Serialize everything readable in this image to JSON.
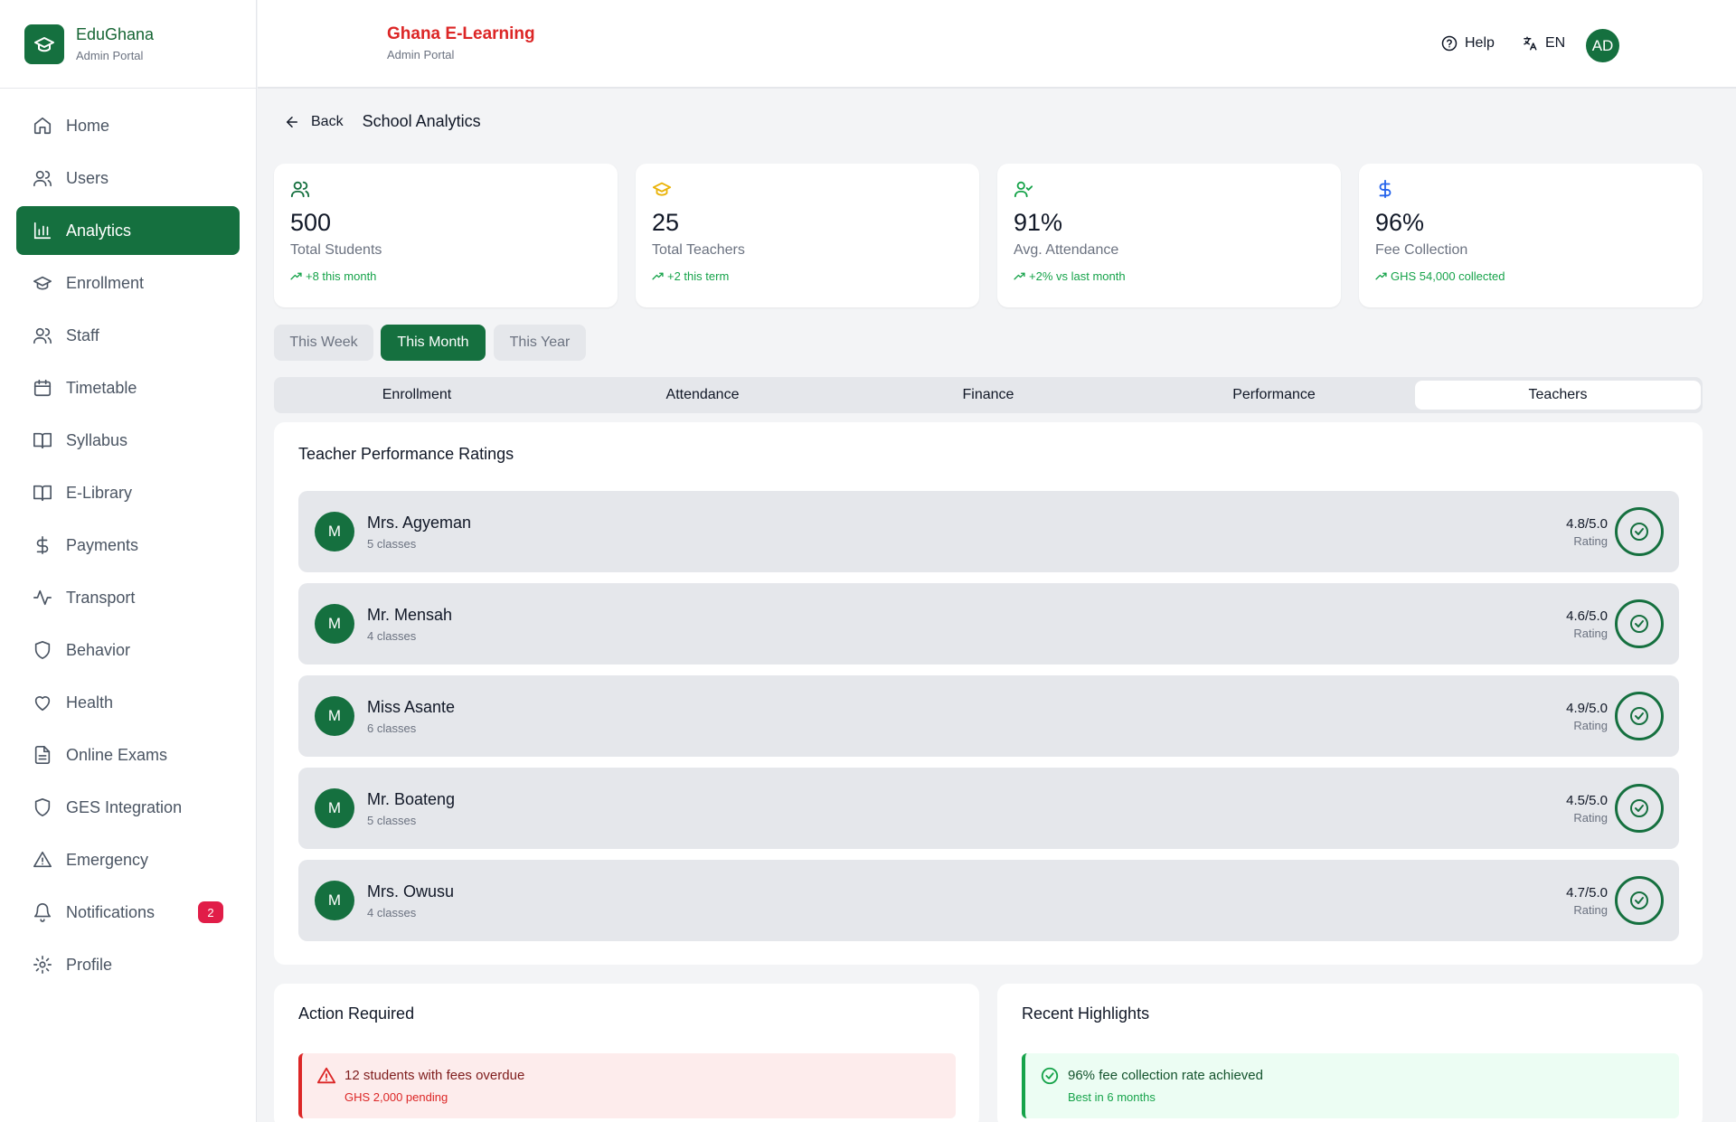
{
  "brand": {
    "name": "EduGhana",
    "subtitle": "Admin Portal"
  },
  "sidebar": {
    "items": [
      {
        "label": "Home",
        "icon": "home-icon"
      },
      {
        "label": "Users",
        "icon": "users-icon"
      },
      {
        "label": "Analytics",
        "icon": "bar-chart-icon",
        "active": true
      },
      {
        "label": "Enrollment",
        "icon": "graduation-cap-icon"
      },
      {
        "label": "Staff",
        "icon": "users-icon"
      },
      {
        "label": "Timetable",
        "icon": "calendar-icon"
      },
      {
        "label": "Syllabus",
        "icon": "book-open-icon"
      },
      {
        "label": "E-Library",
        "icon": "book-open-icon"
      },
      {
        "label": "Payments",
        "icon": "dollar-icon"
      },
      {
        "label": "Transport",
        "icon": "activity-icon"
      },
      {
        "label": "Behavior",
        "icon": "shield-icon"
      },
      {
        "label": "Health",
        "icon": "heart-icon"
      },
      {
        "label": "Online Exams",
        "icon": "file-text-icon"
      },
      {
        "label": "GES Integration",
        "icon": "shield-icon"
      },
      {
        "label": "Emergency",
        "icon": "alert-triangle-icon"
      },
      {
        "label": "Notifications",
        "icon": "bell-icon",
        "badge": "2"
      },
      {
        "label": "Profile",
        "icon": "gear-icon"
      }
    ]
  },
  "header": {
    "title": "Ghana E-Learning",
    "subtitle": "Admin Portal",
    "help": "Help",
    "lang": "EN",
    "avatar": "AD"
  },
  "breadcrumb": {
    "back": "Back",
    "title": "School Analytics"
  },
  "stats": [
    {
      "value": "500",
      "label": "Total Students",
      "trend": "+8 this month",
      "icon": "users-icon",
      "color": "#15703f"
    },
    {
      "value": "25",
      "label": "Total Teachers",
      "trend": "+2 this term",
      "icon": "graduation-cap-icon",
      "color": "#eab308"
    },
    {
      "value": "91%",
      "label": "Avg. Attendance",
      "trend": "+2% vs last month",
      "icon": "user-check-icon",
      "color": "#16a34a"
    },
    {
      "value": "96%",
      "label": "Fee Collection",
      "trend": "GHS 54,000 collected",
      "icon": "dollar-icon",
      "color": "#2563eb"
    }
  ],
  "periods": [
    {
      "label": "This Week"
    },
    {
      "label": "This Month",
      "active": true
    },
    {
      "label": "This Year"
    }
  ],
  "tabs": [
    {
      "label": "Enrollment"
    },
    {
      "label": "Attendance"
    },
    {
      "label": "Finance"
    },
    {
      "label": "Performance"
    },
    {
      "label": "Teachers",
      "active": true
    }
  ],
  "teachers": {
    "title": "Teacher Performance Ratings",
    "rating_label": "Rating",
    "rows": [
      {
        "initial": "M",
        "name": "Mrs. Agyeman",
        "classes": "5 classes",
        "rating": "4.8/5.0"
      },
      {
        "initial": "M",
        "name": "Mr. Mensah",
        "classes": "4 classes",
        "rating": "4.6/5.0"
      },
      {
        "initial": "M",
        "name": "Miss Asante",
        "classes": "6 classes",
        "rating": "4.9/5.0"
      },
      {
        "initial": "M",
        "name": "Mr. Boateng",
        "classes": "5 classes",
        "rating": "4.5/5.0"
      },
      {
        "initial": "M",
        "name": "Mrs. Owusu",
        "classes": "4 classes",
        "rating": "4.7/5.0"
      }
    ]
  },
  "action_required": {
    "title": "Action Required",
    "alert": {
      "text": "12 students with fees overdue",
      "sub": "GHS 2,000 pending",
      "icon": "alert-triangle-icon"
    }
  },
  "highlights": {
    "title": "Recent Highlights",
    "alert": {
      "text": "96% fee collection rate achieved",
      "sub": "Best in 6 months",
      "icon": "check-circle-icon"
    }
  },
  "colors": {
    "brand": "#15703f",
    "danger": "#dc2626",
    "success": "#16a34a",
    "badge": "#e11d48"
  }
}
